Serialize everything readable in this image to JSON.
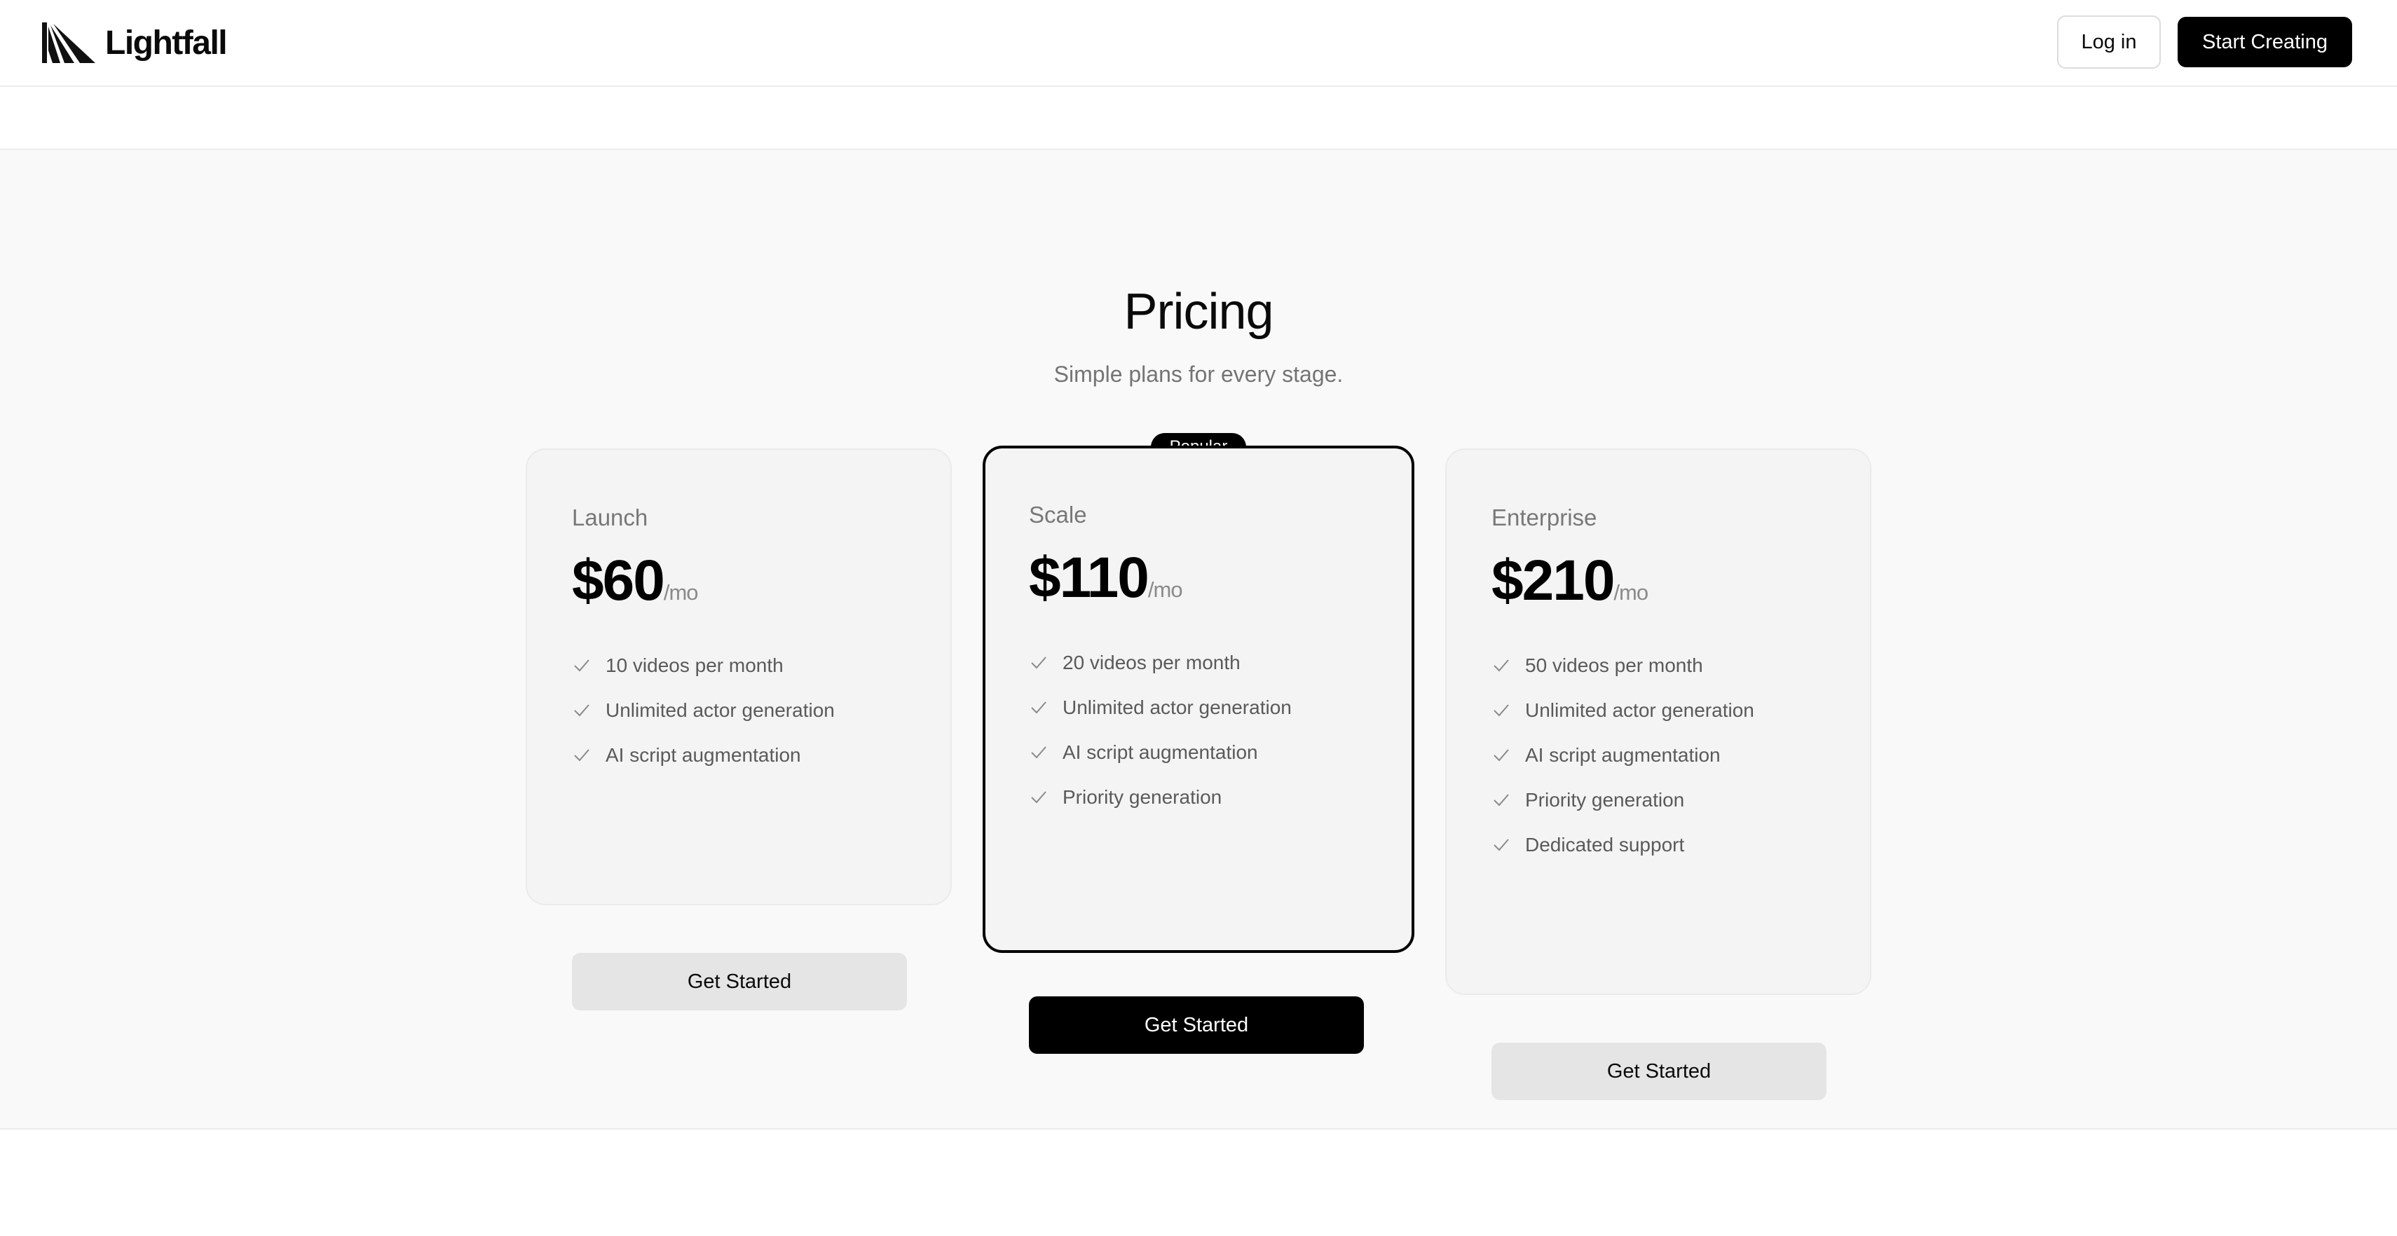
{
  "header": {
    "brand_name": "Lightfall",
    "login_label": "Log in",
    "start_label": "Start Creating"
  },
  "pricing": {
    "title": "Pricing",
    "subtitle": "Simple plans for every stage.",
    "popular_badge": "Popular",
    "plans": [
      {
        "name": "Launch",
        "price": "$60",
        "period": "/mo",
        "features": [
          "10 videos per month",
          "Unlimited actor generation",
          "AI script augmentation"
        ],
        "button": "Get Started"
      },
      {
        "name": "Scale",
        "price": "$110",
        "period": "/mo",
        "features": [
          "20 videos per month",
          "Unlimited actor generation",
          "AI script augmentation",
          "Priority generation"
        ],
        "button": "Get Started"
      },
      {
        "name": "Enterprise",
        "price": "$210",
        "period": "/mo",
        "features": [
          "50 videos per month",
          "Unlimited actor generation",
          "AI script augmentation",
          "Priority generation",
          "Dedicated support"
        ],
        "button": "Get Started"
      }
    ]
  },
  "colors": {
    "primary": "#000000",
    "section_bg": "#f9f9f9",
    "card_bg": "#f4f4f4",
    "muted_text": "#747474"
  },
  "icons": {
    "logo": "lightfall-logo-icon",
    "feature_check": "check-icon"
  }
}
